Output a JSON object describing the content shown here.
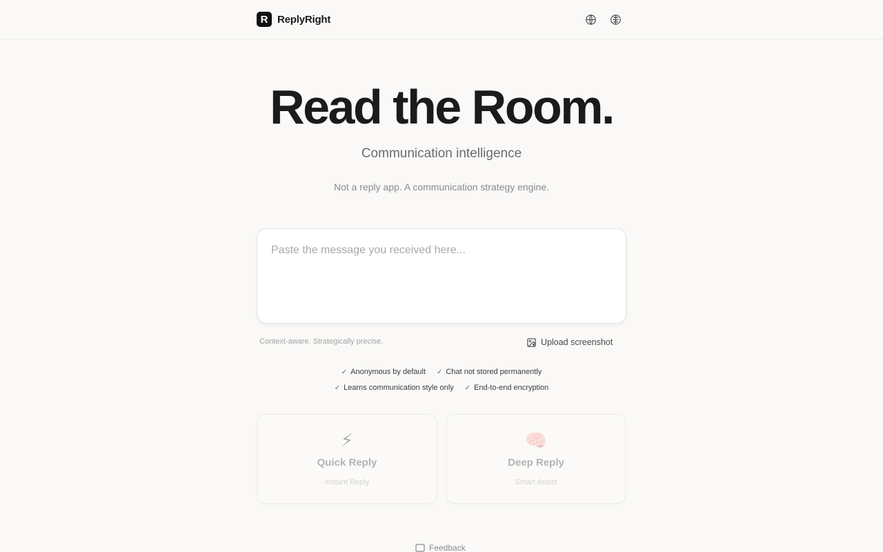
{
  "header": {
    "logo_letter": "R",
    "brand_name": "ReplyRight",
    "icons": [
      "globe-icon",
      "brain-icon"
    ]
  },
  "hero": {
    "title": "Read the Room.",
    "subtitle": "Communication intelligence",
    "tagline": "Not a reply app. A communication strategy engine."
  },
  "input": {
    "placeholder": "Paste the message you received here...",
    "value": ""
  },
  "hint": "Context-aware. Strategically precise.",
  "upload": {
    "label": "Upload screenshot",
    "icon": "image-upload-icon"
  },
  "badges": {
    "row1": [
      "Anonymous by default",
      "Chat not stored permanently"
    ],
    "row2": [
      "Learns communication style only",
      "End-to-end encryption"
    ],
    "check": "✓"
  },
  "modes": [
    {
      "emoji": "⚡",
      "title": "Quick Reply",
      "subtitle": "Instant Reply"
    },
    {
      "emoji": "🧠",
      "title": "Deep Reply",
      "subtitle": "Smart Assist"
    }
  ],
  "footer": {
    "feedback_label": "Feedback",
    "icon": "message-square-icon"
  },
  "colors": {
    "background": "#faf9f7",
    "text": "#1b1b1b",
    "muted": "#8a8a8a"
  }
}
